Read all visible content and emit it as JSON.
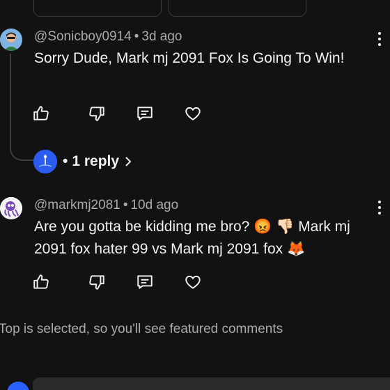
{
  "comments": [
    {
      "author": "@Sonicboy0914",
      "time": "3d ago",
      "body": "Sorry Dude, Mark mj 2091 Fox Is Going To Win!",
      "replies_label": "1 reply"
    },
    {
      "author": "@markmj2081",
      "time": "10d ago",
      "body_part1": "Are you gotta be kidding me bro? ",
      "emoji_angry": "😡",
      "emoji_thumbs": "👎🏻",
      "body_part2": " Mark mj 2091 fox hater 99 vs Mark mj 2091 fox ",
      "emoji_fox": "🦊"
    }
  ],
  "separator": "•",
  "footer_note": "Top is selected, so you'll see featured comments",
  "colors": {
    "background": "#121212",
    "text_primary": "#f1f1f1",
    "text_secondary": "#aaaaaa",
    "input_background": "#2a2a2a",
    "reply_avatar": "#2962ff"
  },
  "icons": {
    "like": "thumbs-up-outline",
    "dislike": "thumbs-down-outline",
    "reply": "comment-outline",
    "heart": "heart-outline",
    "more": "vertical-dots",
    "chevron": "chevron-right"
  }
}
